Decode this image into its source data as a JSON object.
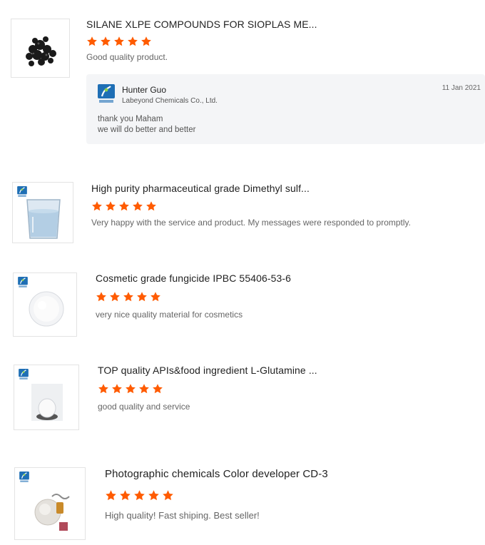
{
  "reviews": [
    {
      "title": "SILANE XLPE COMPOUNDS FOR SIOPLAS ME...",
      "rating": 5,
      "comment": "Good quality product.",
      "image_icon": "black-pellets-image",
      "reply": {
        "name": "Hunter Guo",
        "company": "Labeyond Chemicals Co., Ltd.",
        "date": "11 Jan 2021",
        "lines": [
          "thank you Maham",
          "we will do better and better"
        ]
      }
    },
    {
      "title": "High purity pharmaceutical grade Dimethyl sulf...",
      "rating": 5,
      "comment": "Very happy with the service and product. My messages were responded to promptly.",
      "image_icon": "liquid-beaker-image"
    },
    {
      "title": "Cosmetic grade fungicide IPBC 55406-53-6",
      "rating": 5,
      "comment": "very nice quality material for cosmetics",
      "image_icon": "white-powder-image"
    },
    {
      "title": "TOP quality APIs&food ingredient L-Glutamine ...",
      "rating": 5,
      "comment": "good quality and service",
      "image_icon": "powder-on-dish-image"
    },
    {
      "title": "Photographic chemicals Color developer CD-3",
      "rating": 5,
      "comment": "High quality!  Fast shiping. Best seller!",
      "image_icon": "chemical-products-image"
    }
  ],
  "colors": {
    "star": "#ff5b00",
    "reply_bg": "#f4f5f7",
    "brand_blue": "#1f6fb5"
  }
}
